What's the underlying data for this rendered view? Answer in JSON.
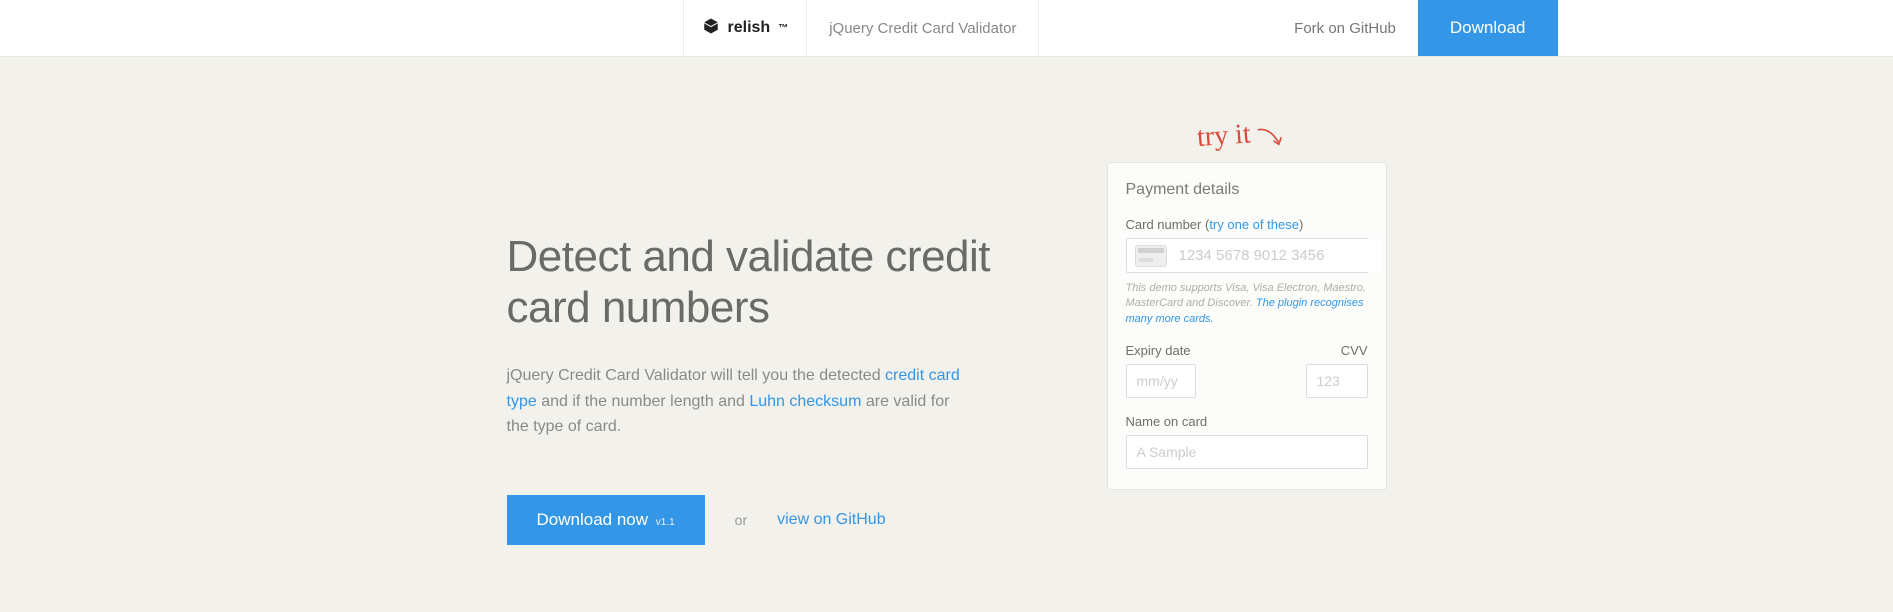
{
  "nav": {
    "brand": "relish",
    "product": "jQuery Credit Card Validator",
    "fork": "Fork on GitHub",
    "download": "Download"
  },
  "hero": {
    "title": "Detect and validate credit card numbers",
    "lead_1": "jQuery Credit Card Validator will tell you the detected ",
    "lead_link1": "credit card type",
    "lead_2": " and if the number length and ",
    "lead_link2": "Luhn checksum",
    "lead_3": " are valid for the type of card."
  },
  "actions": {
    "download": "Download now",
    "version": "v1.1",
    "or": "or",
    "github": "view on GitHub"
  },
  "tryit": "try it",
  "form": {
    "title": "Payment details",
    "cc_label_pre": "Card number (",
    "cc_label_link": "try one of these",
    "cc_label_post": ")",
    "cc_placeholder": "1234 5678 9012 3456",
    "hint_1": "This demo supports Visa, Visa Electron, Maestro, MasterCard and Discover. ",
    "hint_link": "The plugin recognises many more cards.",
    "expiry_label": "Expiry date",
    "expiry_placeholder": "mm/yy",
    "cvv_label": "CVV",
    "cvv_placeholder": "123",
    "name_label": "Name on card",
    "name_placeholder": "A Sample"
  }
}
